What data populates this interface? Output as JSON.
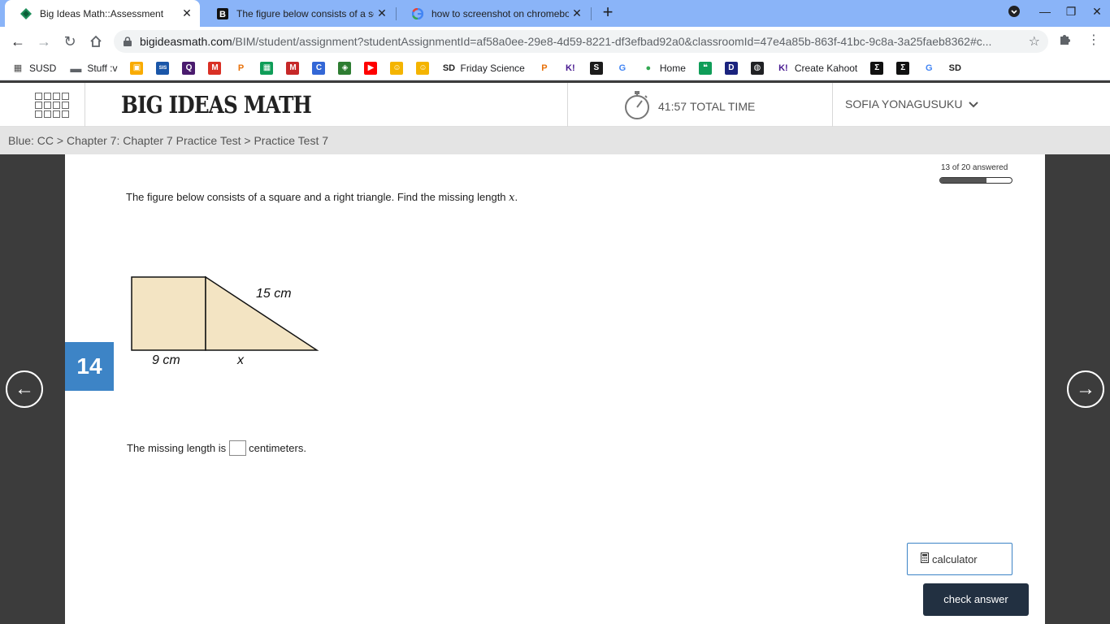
{
  "browser": {
    "tabs": [
      {
        "title": "Big Ideas Math::Assessment",
        "active": true
      },
      {
        "title": "The figure below consists of a sq",
        "active": false
      },
      {
        "title": "how to screenshot on chromebo",
        "active": false
      }
    ],
    "url_host": "bigideasmath.com",
    "url_path": "/BIM/student/assignment?studentAssignmentId=af58a0ee-29e8-4d59-8221-df3efbad92a0&classroomId=47e4a85b-863f-41bc-9c8a-3a25faeb8362#c..."
  },
  "bookmarks": [
    {
      "label": "SUSD",
      "icon": "susd-icon",
      "color": "#4a4a4a"
    },
    {
      "label": "Stuff :v",
      "icon": "folder-icon",
      "color": "#5f6368"
    },
    {
      "label": "",
      "icon": "classroom-icon",
      "color": "#f9ab00"
    },
    {
      "label": "",
      "icon": "sis-icon",
      "color": "#1a56a8"
    },
    {
      "label": "",
      "icon": "quizlet-icon",
      "color": "#4a1b6e"
    },
    {
      "label": "",
      "icon": "gmail-icon",
      "color": "#d93025"
    },
    {
      "label": "",
      "icon": "pear-icon",
      "color": "#e8710a"
    },
    {
      "label": "",
      "icon": "sheets-icon",
      "color": "#0f9d58"
    },
    {
      "label": "",
      "icon": "m-icon",
      "color": "#c62828"
    },
    {
      "label": "",
      "icon": "c-icon",
      "color": "#3367d6"
    },
    {
      "label": "",
      "icon": "game-icon",
      "color": "#2e7d32"
    },
    {
      "label": "",
      "icon": "youtube-icon",
      "color": "#ff0000"
    },
    {
      "label": "",
      "icon": "face-icon",
      "color": "#f4b400"
    },
    {
      "label": "",
      "icon": "face-icon",
      "color": "#f4b400"
    },
    {
      "label": "Friday Science",
      "icon": "sd-icon",
      "color": "#222222"
    },
    {
      "label": "",
      "icon": "pear-icon",
      "color": "#e8710a"
    },
    {
      "label": "",
      "icon": "kahoot-icon",
      "color": "#46178f"
    },
    {
      "label": "",
      "icon": "s-icon",
      "color": "#1b1b1b"
    },
    {
      "label": "",
      "icon": "google-icon",
      "color": "#4285f4"
    },
    {
      "label": "Home",
      "icon": "maps-icon",
      "color": "#34a853"
    },
    {
      "label": "",
      "icon": "hangouts-icon",
      "color": "#0f9d58"
    },
    {
      "label": "",
      "icon": "d-icon",
      "color": "#1a237e"
    },
    {
      "label": "",
      "icon": "globe-icon",
      "color": "#202124"
    },
    {
      "label": "Create Kahoot",
      "icon": "kahoot-icon",
      "color": "#46178f"
    },
    {
      "label": "",
      "icon": "sigma-icon",
      "color": "#111111"
    },
    {
      "label": "",
      "icon": "sigma-icon",
      "color": "#111111"
    },
    {
      "label": "",
      "icon": "google-icon",
      "color": "#4285f4"
    },
    {
      "label": "",
      "icon": "sd-icon",
      "color": "#222222"
    }
  ],
  "header": {
    "logo": "BIG IDEAS MATH",
    "time": "41:57",
    "time_label": "TOTAL TIME",
    "user": "SOFIA YONAGUSUKU"
  },
  "breadcrumb": "Blue: CC > Chapter 7: Chapter 7 Practice Test > Practice Test 7",
  "question": {
    "number": "14",
    "progress_label": "13 of 20 answered",
    "progress_fraction": 0.65,
    "text_before": "The figure below consists of a square and a right triangle. Find the missing length ",
    "variable": "x",
    "text_after": ".",
    "figure": {
      "hypotenuse_label": "15 cm",
      "square_side_label": "9 cm",
      "unknown_label": "x"
    },
    "answer_before": "The missing length is",
    "answer_after": "centimeters."
  },
  "buttons": {
    "calculator": "calculator",
    "check": "check answer"
  },
  "colors": {
    "figure_fill": "#f3e4c3",
    "question_badge": "#3d84c6",
    "check_button": "#223041"
  }
}
